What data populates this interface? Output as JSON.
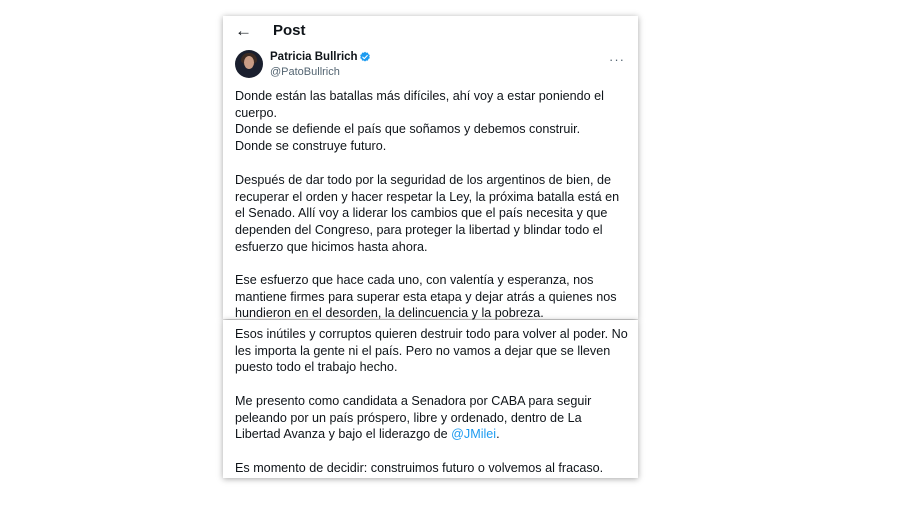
{
  "header": {
    "back_icon": "arrow-left-icon",
    "title": "Post"
  },
  "author": {
    "name": "Patricia Bullrich",
    "handle": "@PatoBullrich",
    "verified_icon": "verified-badge-icon",
    "more_label": "···"
  },
  "post": {
    "p1": "Donde están las batallas más difíciles, ahí voy a estar poniendo el cuerpo.\nDonde se defiende el país que soñamos y debemos construir.\nDonde se construye futuro.",
    "p2": "Después de dar todo por la seguridad de los argentinos de bien, de recuperar el orden y hacer respetar la Ley, la próxima batalla está en el Senado. Allí voy a liderar los cambios que el país necesita y que dependen del Congreso, para proteger la libertad y blindar todo el esfuerzo que hicimos hasta ahora.",
    "p3": "Ese esfuerzo que hace cada uno, con valentía y esperanza, nos mantiene firmes para superar esta etapa y dejar atrás a quienes nos hundieron en el desorden, la delincuencia y la pobreza.",
    "p4": "Esos inútiles y corruptos quieren destruir todo para volver al poder. No les importa la gente ni el país. Pero no vamos a dejar que se lleven puesto todo el trabajo hecho.",
    "p5_text": "Me presento como candidata a Senadora por CABA para seguir peleando por un país próspero, libre y ordenado, dentro de La Libertad Avanza y bajo el liderazgo de ",
    "p5_mention": "@JMilei",
    "p5_end": ".",
    "p6": "Es momento de decidir: construimos futuro o volvemos al fracaso."
  },
  "colors": {
    "link": "#1d9bf0",
    "text": "#0f1419",
    "secondary": "#536471"
  }
}
